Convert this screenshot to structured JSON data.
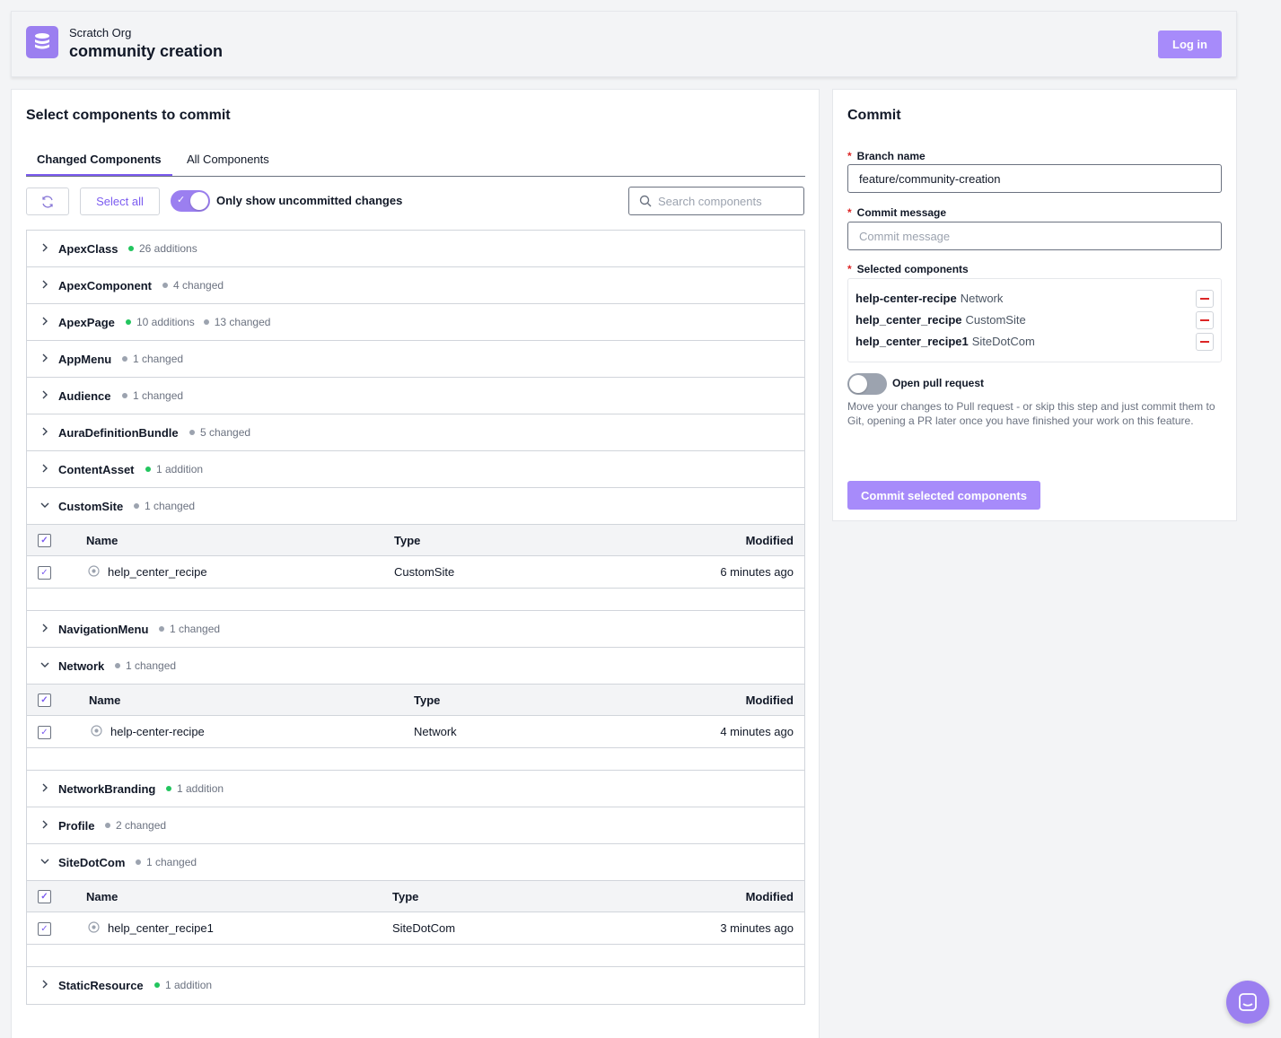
{
  "header": {
    "org_label": "Scratch Org",
    "org_name": "community creation",
    "login_label": "Log in",
    "logo_icon": "database-icon"
  },
  "left": {
    "title": "Select components to commit",
    "tabs": [
      "Changed Components",
      "All Components"
    ],
    "select_all_label": "Select all",
    "toggle_label": "Only show uncommitted changes",
    "toggle_on": true,
    "search_placeholder": "Search components"
  },
  "components": [
    {
      "name": "ApexClass",
      "stats": [
        {
          "dot": "green",
          "text": "26 additions"
        }
      ],
      "expanded": false
    },
    {
      "name": "ApexComponent",
      "stats": [
        {
          "dot": "gray",
          "text": "4 changed"
        }
      ],
      "expanded": false
    },
    {
      "name": "ApexPage",
      "stats": [
        {
          "dot": "green",
          "text": "10 additions"
        },
        {
          "dot": "gray",
          "text": "13 changed"
        }
      ],
      "expanded": false
    },
    {
      "name": "AppMenu",
      "stats": [
        {
          "dot": "gray",
          "text": "1 changed"
        }
      ],
      "expanded": false
    },
    {
      "name": "Audience",
      "stats": [
        {
          "dot": "gray",
          "text": "1 changed"
        }
      ],
      "expanded": false
    },
    {
      "name": "AuraDefinitionBundle",
      "stats": [
        {
          "dot": "gray",
          "text": "5 changed"
        }
      ],
      "expanded": false
    },
    {
      "name": "ContentAsset",
      "stats": [
        {
          "dot": "green",
          "text": "1 addition"
        }
      ],
      "expanded": false
    },
    {
      "name": "CustomSite",
      "stats": [
        {
          "dot": "gray",
          "text": "1 changed"
        }
      ],
      "expanded": true,
      "headers": [
        "Name",
        "Type",
        "Modified"
      ],
      "items": [
        {
          "name": "help_center_recipe",
          "type": "CustomSite",
          "modified": "6 minutes ago",
          "checked": true
        }
      ]
    },
    {
      "name": "NavigationMenu",
      "stats": [
        {
          "dot": "gray",
          "text": "1 changed"
        }
      ],
      "expanded": false
    },
    {
      "name": "Network",
      "stats": [
        {
          "dot": "gray",
          "text": "1 changed"
        }
      ],
      "expanded": true,
      "headers": [
        "Name",
        "Type",
        "Modified"
      ],
      "items": [
        {
          "name": "help-center-recipe",
          "type": "Network",
          "modified": "4 minutes ago",
          "checked": true
        }
      ]
    },
    {
      "name": "NetworkBranding",
      "stats": [
        {
          "dot": "green",
          "text": "1 addition"
        }
      ],
      "expanded": false
    },
    {
      "name": "Profile",
      "stats": [
        {
          "dot": "gray",
          "text": "2 changed"
        }
      ],
      "expanded": false
    },
    {
      "name": "SiteDotCom",
      "stats": [
        {
          "dot": "gray",
          "text": "1 changed"
        }
      ],
      "expanded": true,
      "headers": [
        "Name",
        "Type",
        "Modified"
      ],
      "items": [
        {
          "name": "help_center_recipe1",
          "type": "SiteDotCom",
          "modified": "3 minutes ago",
          "checked": true
        }
      ]
    },
    {
      "name": "StaticResource",
      "stats": [
        {
          "dot": "green",
          "text": "1 addition"
        }
      ],
      "expanded": false
    }
  ],
  "commit": {
    "title": "Commit",
    "branch_label": "Branch name",
    "branch_value": "feature/community-creation",
    "message_label": "Commit message",
    "message_placeholder": "Commit message",
    "selected_label": "Selected components",
    "selected": [
      {
        "name": "help-center-recipe",
        "type": "Network"
      },
      {
        "name": "help_center_recipe",
        "type": "CustomSite"
      },
      {
        "name": "help_center_recipe1",
        "type": "SiteDotCom"
      }
    ],
    "pr_label": "Open pull request",
    "pr_on": false,
    "pr_description": "Move your changes to Pull request - or skip this step and just commit them to Git, opening a PR later once you have finished your work on this feature.",
    "commit_button": "Commit selected components"
  },
  "colors": {
    "accent": "#9b7ff0",
    "button": "#a78bfa",
    "addition": "#22c55e",
    "changed": "#9ca3af",
    "required": "#dc2626"
  }
}
